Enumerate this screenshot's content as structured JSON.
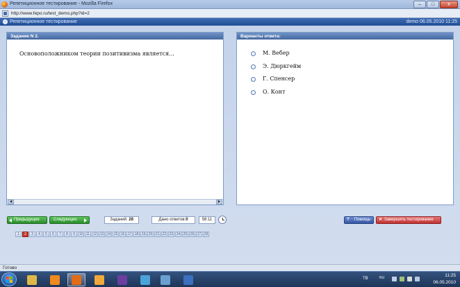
{
  "window": {
    "title": "Репетиционное тестирование - Mozilla Firefox",
    "controls": {
      "minimize": "–",
      "maximize": "□",
      "close": "x"
    }
  },
  "address": {
    "url": "http://www.fepo.ru/test_demo.php?id=2"
  },
  "app_header": {
    "title": "Репетиционное тестирование",
    "user_info": "demo 06.05.2010 11:25"
  },
  "question_panel": {
    "header": "Задание N 2.",
    "text": "Основоположником теории позитивизма является..."
  },
  "answers_panel": {
    "header": "Варианты ответа:",
    "options": [
      {
        "label": "М. Вебер"
      },
      {
        "label": "Э. Дюркгейм"
      },
      {
        "label": "Г. Спенсер"
      },
      {
        "label": "О. Конт"
      }
    ]
  },
  "controls": {
    "prev_label": "Предыдущее",
    "next_label": "Следующее",
    "tasks_label": "Заданий:",
    "tasks_count": "28",
    "answered_label": "Дано ответов:",
    "answered_count": "0",
    "timer": "58:11",
    "help_label": "Помощь",
    "help_mark": "?",
    "finish_label": "Завершить тестирование",
    "finish_mark": "✕"
  },
  "pager": {
    "current": "2",
    "pages": [
      "1",
      "2",
      "3",
      "4",
      "5",
      "6",
      "7",
      "8",
      "9",
      "10",
      "11",
      "12",
      "13",
      "14",
      "15",
      "16",
      "17",
      "18",
      "19",
      "20",
      "21",
      "22",
      "23",
      "24",
      "25",
      "26",
      "27",
      "28"
    ]
  },
  "status": {
    "text": "Готово"
  },
  "taskbar": {
    "lang": "TB",
    "kbd": "RU",
    "time": "11:25",
    "date": "06.05.2010",
    "apps": [
      {
        "name": "explorer-icon",
        "color": "#e0b84a"
      },
      {
        "name": "vlc-icon",
        "color": "#f08a1c"
      },
      {
        "name": "firefox-icon",
        "color": "#e26b17",
        "active": true
      },
      {
        "name": "media-player-icon",
        "color": "#f2a93b"
      },
      {
        "name": "save-icon",
        "color": "#6a3fa0"
      },
      {
        "name": "network-icon",
        "color": "#4aa3d8"
      },
      {
        "name": "screen-icon",
        "color": "#6aa0d0"
      },
      {
        "name": "document-icon",
        "color": "#3d6fbf"
      }
    ]
  },
  "colors": {
    "header_blue": "#204e95",
    "panel_head": "#46699f",
    "green_button": "#2a8b2a",
    "red_button": "#c03232",
    "active_page": "#c73a2e"
  }
}
